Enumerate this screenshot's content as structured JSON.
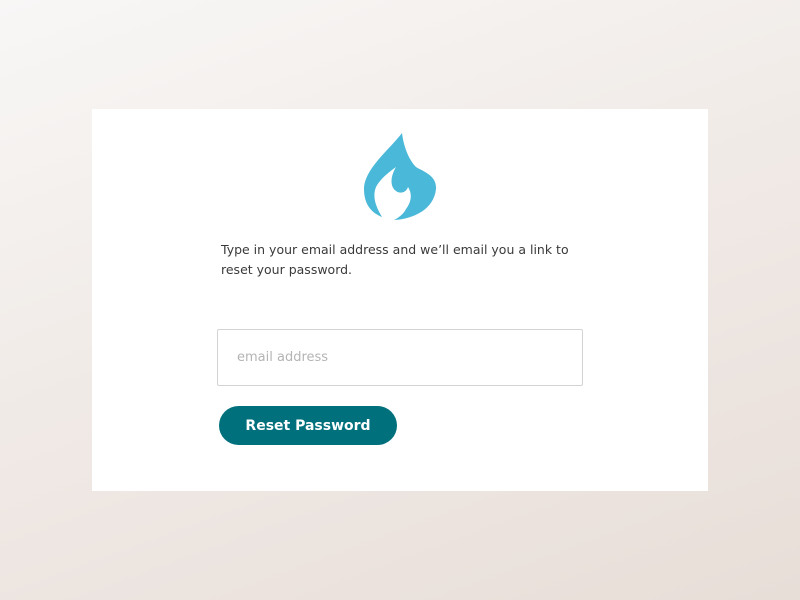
{
  "logo": {
    "icon": "flame-icon",
    "color": "#4ab8d8"
  },
  "instructions": "Type in your email address and we’ll email you a link to reset your password.",
  "email_field": {
    "placeholder": "email address",
    "value": ""
  },
  "reset_button": {
    "label": "Reset Password",
    "color": "#00707d"
  }
}
